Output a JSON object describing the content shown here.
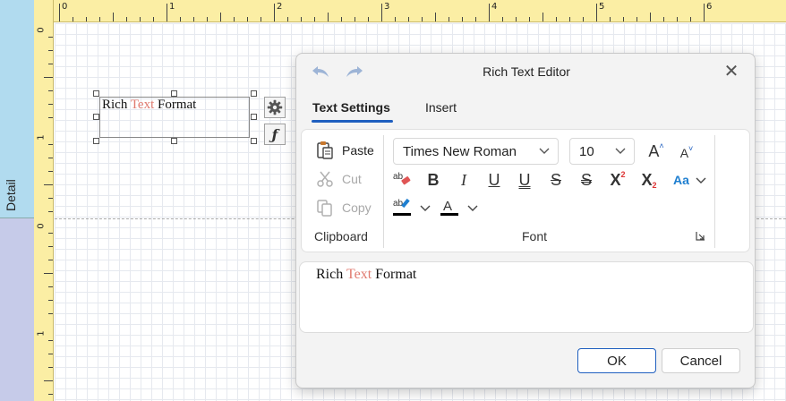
{
  "band": {
    "label": "Detail"
  },
  "ruler": {
    "horizontal_numbers": [
      "0",
      "1",
      "2",
      "3",
      "4",
      "5",
      "6"
    ],
    "vertical_numbers": [
      "0",
      "1",
      "0",
      "1"
    ]
  },
  "control": {
    "text_parts": [
      "Rich ",
      "Text",
      " Format"
    ],
    "highlight_color": "#e07a6f"
  },
  "dialog": {
    "title": "Rich Text Editor",
    "tabs": [
      {
        "label": "Text Settings",
        "active": true
      },
      {
        "label": "Insert",
        "active": false
      }
    ],
    "clipboard": {
      "paste_label": "Paste",
      "cut_label": "Cut",
      "copy_label": "Copy",
      "group_label": "Clipboard"
    },
    "font": {
      "family": "Times New Roman",
      "size": "10",
      "group_label": "Font",
      "case_label": "Aa"
    },
    "editor": {
      "text_parts": [
        "Rich ",
        "Text",
        " Format"
      ]
    },
    "ok_label": "OK",
    "cancel_label": "Cancel"
  },
  "colors": {
    "accent": "#1f5fbf",
    "detail_band": "#b1dbef",
    "footer_band": "#c6cbe9",
    "ruler": "#fbeea4",
    "highlight_bar": "#000000",
    "font_color_bar": "#000000"
  }
}
